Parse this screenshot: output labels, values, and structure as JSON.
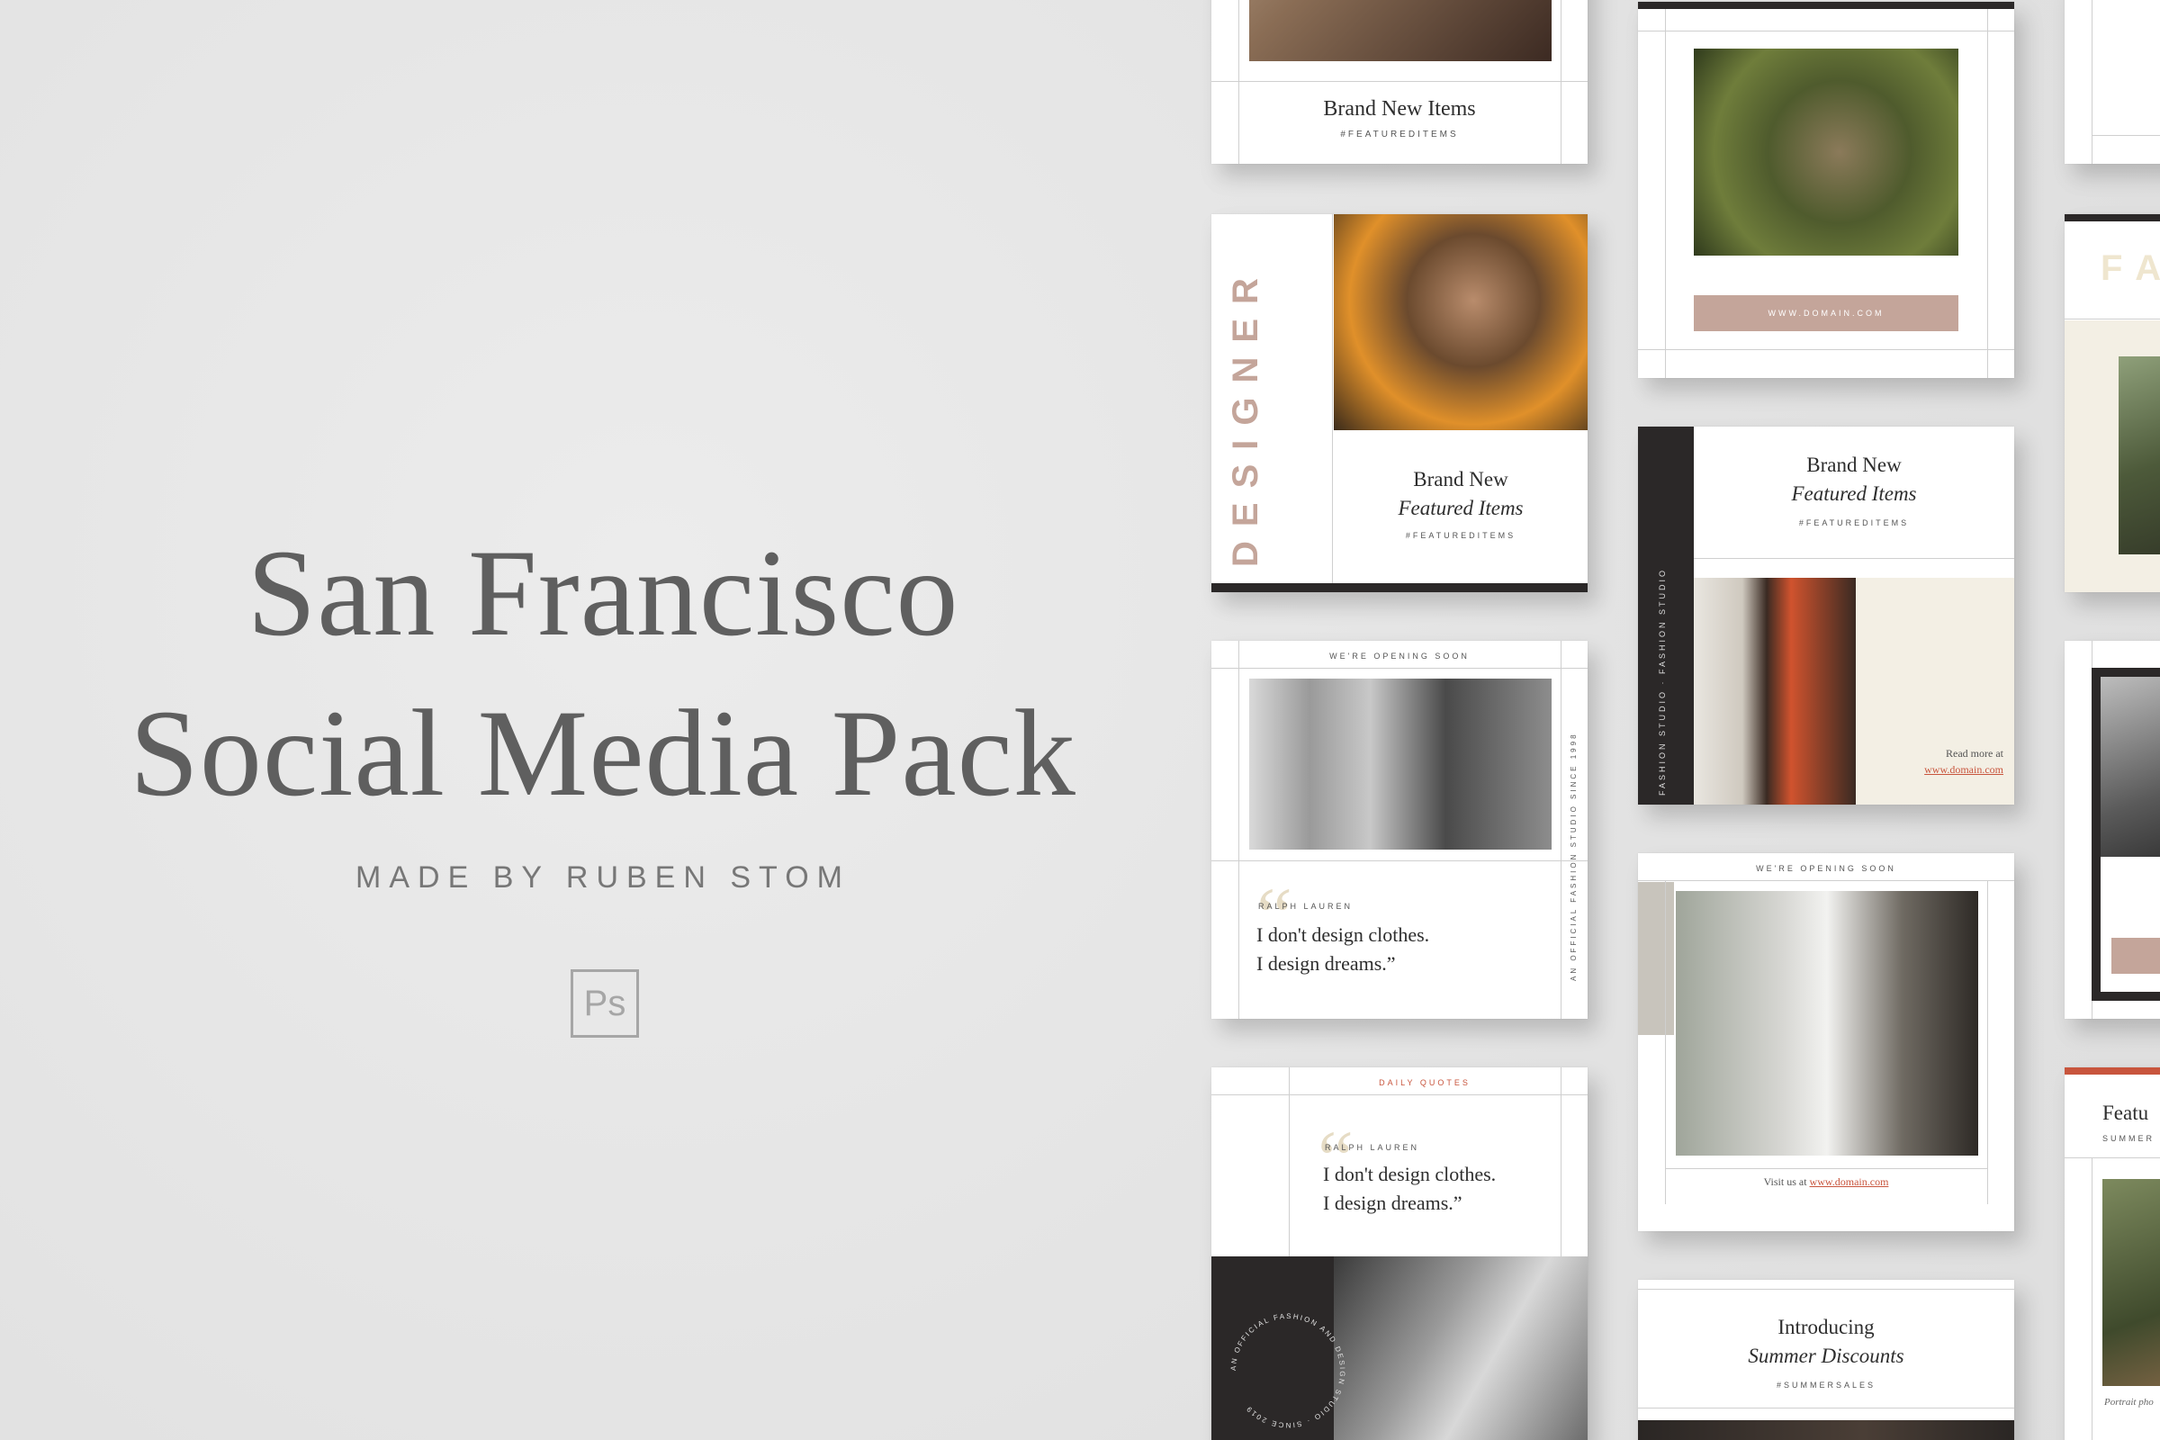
{
  "hero": {
    "title_line1": "San Francisco",
    "title_line2": "Social Media Pack",
    "subtitle": "MADE BY RUBEN STOM",
    "ps_icon_label": "Ps"
  },
  "cards": {
    "c1": {
      "title": "Brand New Items",
      "tag": "#FEATUREDITEMS"
    },
    "c2": {
      "button": "WWW.DOMAIN.COM"
    },
    "c4": {
      "vertical": "DESIGNER",
      "title1": "Brand New",
      "title2": "Featured Items",
      "tag": "#FEATUREDITEMS"
    },
    "c5": {
      "side": "FASHION STUDIO · FASHION STUDIO",
      "title1": "Brand New",
      "title2": "Featured Items",
      "tag": "#FEATUREDITEMS",
      "read": "Read more at",
      "link": "www.domain.com"
    },
    "c7": {
      "top": "WE'RE OPENING SOON",
      "author": "RALPH LAUREN",
      "quote1": "I don't design clothes.",
      "quote2": "I design dreams.”",
      "side": "AN OFFICIAL FASHION STUDIO SINCE 1998"
    },
    "c8": {
      "top": "WE'RE OPENING SOON",
      "visit": "Visit us at",
      "link": "www.domain.com"
    },
    "c10": {
      "top": "DAILY QUOTES",
      "author": "RALPH LAUREN",
      "quote1": "I don't design clothes.",
      "quote2": "I design dreams.”",
      "circle_text": "AN OFFICIAL FASHION AND DESIGN STUDIO · SINCE 2019"
    },
    "c11": {
      "title1": "Introducing",
      "title2": "Summer Discounts",
      "tag": "#SUMMERSALES"
    },
    "c12": {
      "title": "Featu",
      "tag": "SUMMER",
      "caption": "Portrait pho"
    },
    "c6": {
      "title": "FA"
    }
  },
  "colors": {
    "background": "#e4e4e4",
    "accent_pink": "#c4a59a",
    "accent_red": "#c8553d",
    "dark": "#2b2828"
  }
}
